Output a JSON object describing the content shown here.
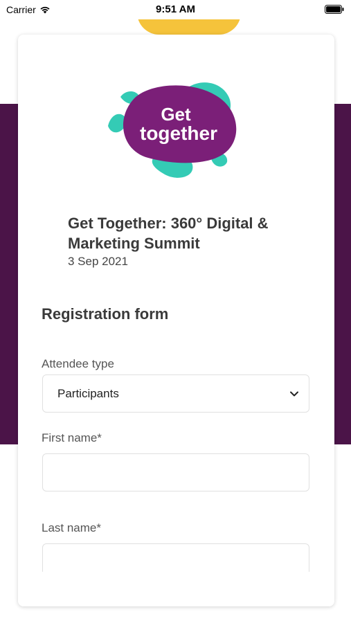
{
  "status_bar": {
    "carrier": "Carrier",
    "time": "9:51 AM"
  },
  "logo": {
    "line1": "Get",
    "line2": "together",
    "colors": {
      "blob": "#7b1f78",
      "accent": "#34cbb5"
    }
  },
  "event": {
    "title": "Get Together: 360° Digital & Marketing Summit",
    "date": "3 Sep 2021"
  },
  "form": {
    "heading": "Registration form",
    "attendee_type": {
      "label": "Attendee type",
      "value": "Participants"
    },
    "first_name": {
      "label": "First name*",
      "value": ""
    },
    "last_name": {
      "label": "Last name*",
      "value": ""
    }
  },
  "colors": {
    "brand_purple": "#4b1448",
    "brand_yellow": "#f5c33b"
  },
  "icons": [
    "wifi-icon",
    "battery-icon",
    "chevron-down-icon"
  ]
}
